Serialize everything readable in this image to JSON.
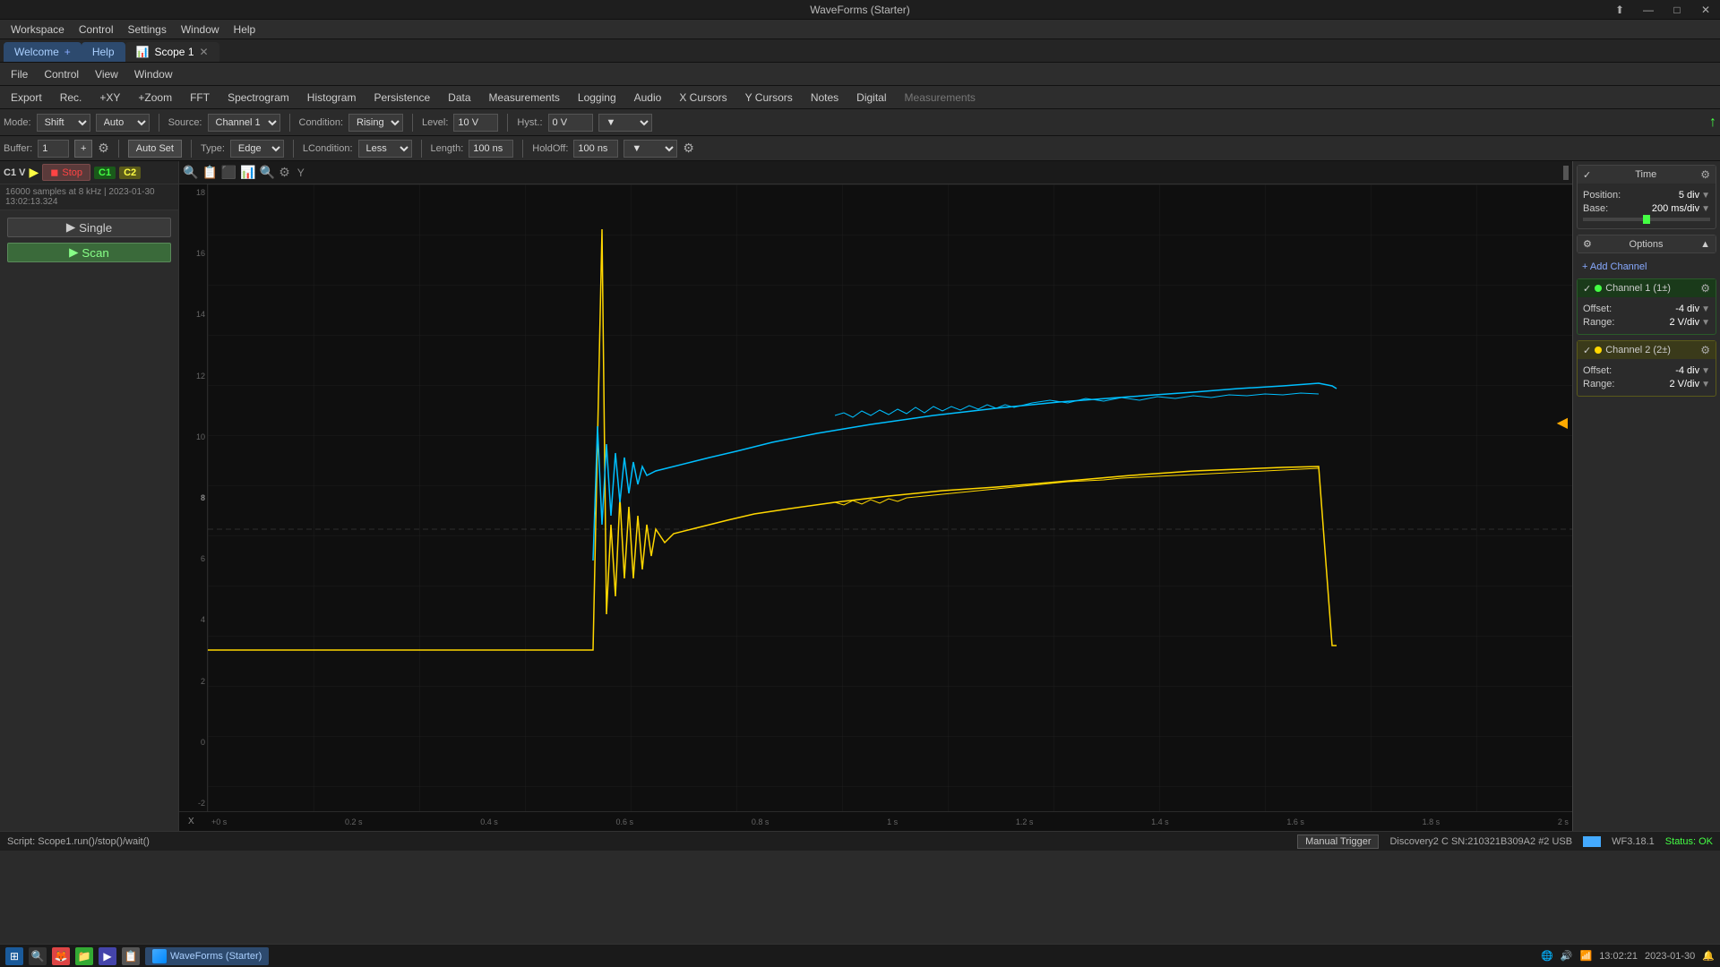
{
  "app": {
    "title": "WaveForms (Starter)",
    "version": "WF3.18.1"
  },
  "titlebar": {
    "title": "WaveForms (Starter)",
    "controls": [
      "▲",
      "—",
      "⬜",
      "✕"
    ]
  },
  "menubar": {
    "items": [
      "Workspace",
      "Control",
      "Settings",
      "Window",
      "Help"
    ]
  },
  "tabs": {
    "items": [
      {
        "label": "Welcome",
        "closable": false,
        "type": "welcome"
      },
      {
        "label": "Help",
        "closable": false,
        "type": "help"
      },
      {
        "label": "Scope 1",
        "closable": true,
        "active": true,
        "type": "scope"
      }
    ],
    "add_label": "+"
  },
  "secondmenu": {
    "items": [
      "File",
      "Control",
      "View",
      "Window"
    ]
  },
  "toolbar": {
    "items": [
      "Export",
      "Rec.",
      "+XY",
      "+Zoom",
      "FFT",
      "Spectrogram",
      "Histogram",
      "Persistence",
      "Data",
      "Measurements",
      "Logging",
      "Audio",
      "X Cursors",
      "Y Cursors",
      "Notes",
      "Digital",
      "Measurements"
    ]
  },
  "trigger_controls": {
    "mode_label": "Mode:",
    "mode_value": "Shift",
    "auto_value": "Auto",
    "source_label": "Source:",
    "source_value": "Channel 1",
    "condition_label": "Condition:",
    "condition_value": "Rising",
    "level_label": "Level:",
    "level_value": "10 V",
    "hyst_label": "Hyst.:",
    "hyst_value": "0 V",
    "buffer_label": "Buffer:",
    "buffer_value": "1",
    "auto_set_label": "Auto Set",
    "type_label": "Type:",
    "type_value": "Edge",
    "lcondition_label": "LCondition:",
    "lcondition_value": "Less",
    "length_label": "Length:",
    "length_value": "100 ns",
    "holdoff_label": "HoldOff:",
    "holdoff_value": "100 ns"
  },
  "scope_header": {
    "c1v": "C1 V",
    "arrow": "▶",
    "stop_label": "Stop",
    "c1_label": "C1",
    "c2_label": "C2",
    "info": "16000 samples at 8 kHz  |  2023-01-30 13:02:13.324"
  },
  "run_buttons": {
    "single": "Single",
    "scan": "Scan",
    "stop": "Stop"
  },
  "y_axis": {
    "labels": [
      "18",
      "16",
      "14",
      "12",
      "10",
      "8",
      "6",
      "4",
      "2",
      "0",
      "-2"
    ]
  },
  "x_axis": {
    "labels": [
      "X",
      "+0 s",
      "0.2 s",
      "0.4 s",
      "0.6 s",
      "0.8 s",
      "1 s",
      "1.2 s",
      "1.4 s",
      "1.6 s",
      "1.8 s",
      "2 s"
    ]
  },
  "right_panel": {
    "time_section": {
      "title": "Time",
      "position_label": "Position:",
      "position_value": "5 div",
      "base_label": "Base:",
      "base_value": "200 ms/div"
    },
    "options_section": {
      "title": "Options"
    },
    "add_channel_label": "+ Add Channel",
    "channel1": {
      "title": "Channel 1 (1±)",
      "offset_label": "Offset:",
      "offset_value": "-4 div",
      "range_label": "Range:",
      "range_value": "2 V/div"
    },
    "channel2": {
      "title": "Channel 2 (2±)",
      "offset_label": "Offset:",
      "offset_value": "-4 div",
      "range_label": "Range:",
      "range_value": "2 V/div"
    }
  },
  "statusbar": {
    "script": "Script: Scope1.run()/stop()/wait()",
    "manual_trigger": "Manual Trigger",
    "device": "Discovery2 C SN:210321B309A2 #2 USB",
    "version": "WF3.18.1",
    "status": "Status: OK",
    "time": "13:02:21",
    "date": "2023-01-30"
  },
  "colors": {
    "ch1": "#00bfff",
    "ch2": "#ffd700",
    "background": "#0a0a0a",
    "grid": "rgba(255,255,255,0.08)",
    "accent": "#4488ff"
  }
}
